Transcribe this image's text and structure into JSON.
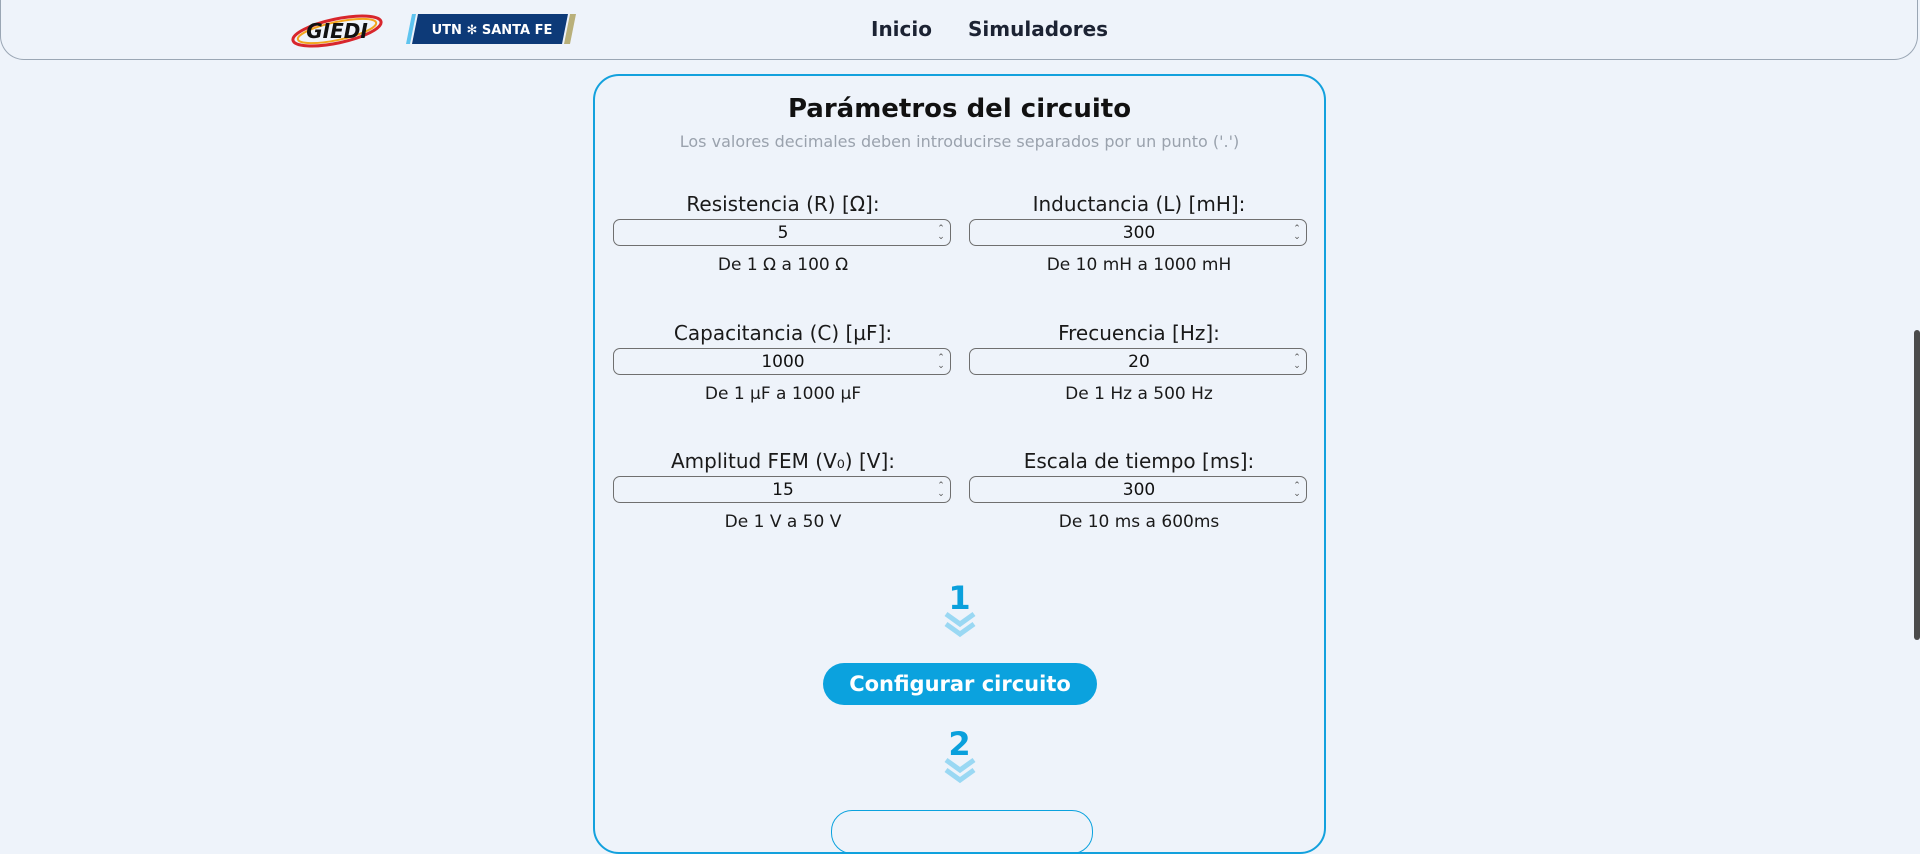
{
  "header": {
    "nav": [
      "Inicio",
      "Simuladores"
    ],
    "logo_gied_text": "GIEDI",
    "logo_utn_text": "UTN ✻ SANTA FE"
  },
  "card": {
    "title": "Parámetros del circuito",
    "subtitle": "Los valores decimales deben introducirse separados por un punto ('.')",
    "fields": [
      {
        "label": "Resistencia (R) [Ω]:",
        "value": "5",
        "hint": "De 1 Ω a 100 Ω"
      },
      {
        "label": "Inductancia (L) [mH]:",
        "value": "300",
        "hint": "De 10 mH a 1000 mH"
      },
      {
        "label": "Capacitancia (C) [µF]:",
        "value": "1000",
        "hint": "De 1 µF a 1000 µF"
      },
      {
        "label": "Frecuencia [Hz]:",
        "value": "20",
        "hint": "De 1 Hz a 500 Hz"
      },
      {
        "label": "Amplitud FEM (V₀) [V]:",
        "value": "15",
        "hint": "De 1 V a 50 V"
      },
      {
        "label": "Escala de tiempo [ms]:",
        "value": "300",
        "hint": "De 10 ms a 600ms"
      }
    ],
    "step1": "1",
    "step2": "2",
    "configure_button": "Configurar circuito"
  },
  "colors": {
    "accent": "#0ba2de",
    "background": "#eef3fa",
    "logo_red": "#d8262c",
    "logo_navy": "#0d3a78"
  }
}
